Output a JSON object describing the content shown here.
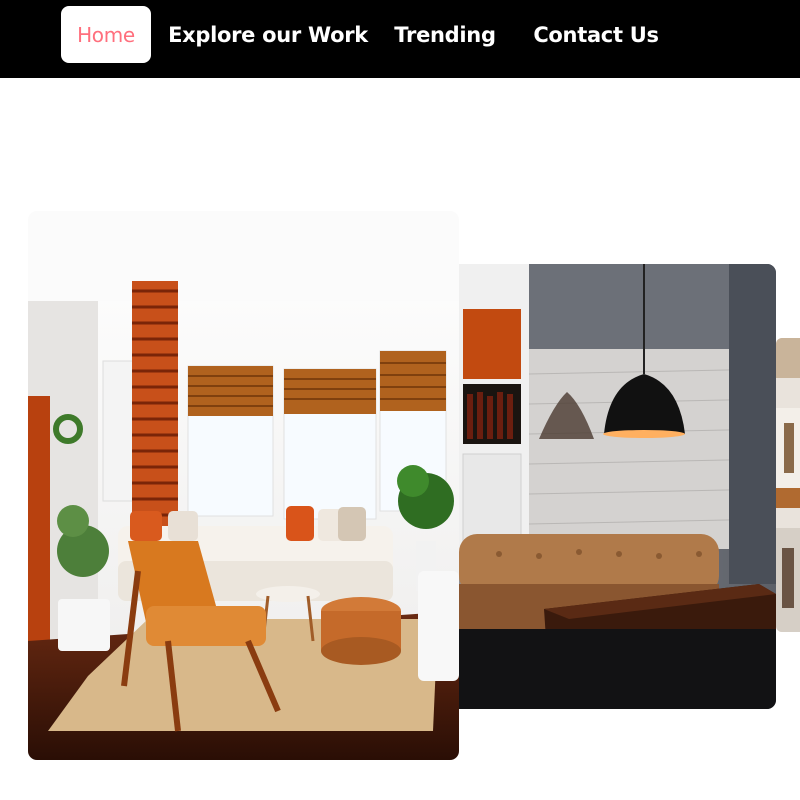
{
  "nav": {
    "items": [
      {
        "label": "Home",
        "active": true
      },
      {
        "label": "Explore our Work",
        "active": false
      },
      {
        "label": "Trending",
        "active": false
      },
      {
        "label": "Contact Us",
        "active": false
      }
    ],
    "background": "#000000",
    "active_text_color": "#ff6f7d"
  },
  "gallery": {
    "images": [
      {
        "subject": "bright living room with orange armchair and white sofa"
      },
      {
        "subject": "dim lounge with tufted leather sofa and black pendant lamp"
      },
      {
        "subject": "partially visible restaurant interior"
      }
    ]
  }
}
